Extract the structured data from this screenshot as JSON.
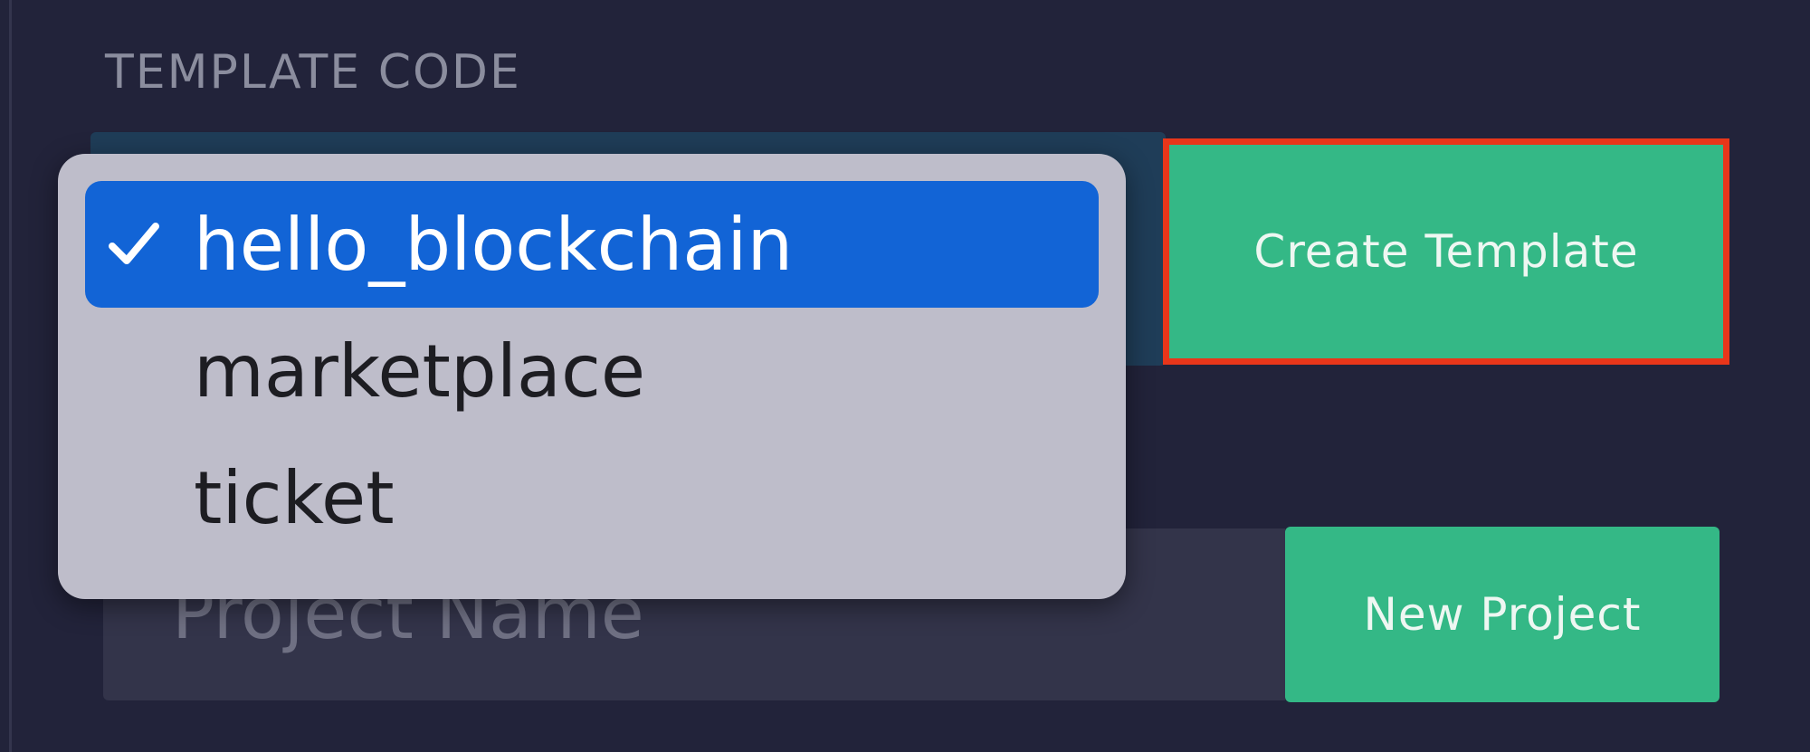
{
  "form": {
    "section_label": "TEMPLATE CODE",
    "create_button_label": "Create Template",
    "new_project_button_label": "New Project",
    "project_name_placeholder": "Project Name",
    "project_name_value": ""
  },
  "dropdown": {
    "selected": "hello_blockchain",
    "options": [
      {
        "label": "hello_blockchain",
        "selected": true
      },
      {
        "label": "marketplace",
        "selected": false
      },
      {
        "label": "ticket",
        "selected": false
      }
    ]
  },
  "colors": {
    "background": "#22233a",
    "accent_green": "#34b886",
    "highlight_outline": "#e8361a",
    "selection_blue": "#1264d6",
    "menu_background": "#bebdca"
  },
  "icons": {
    "selected_marker": "checkmark-icon"
  }
}
